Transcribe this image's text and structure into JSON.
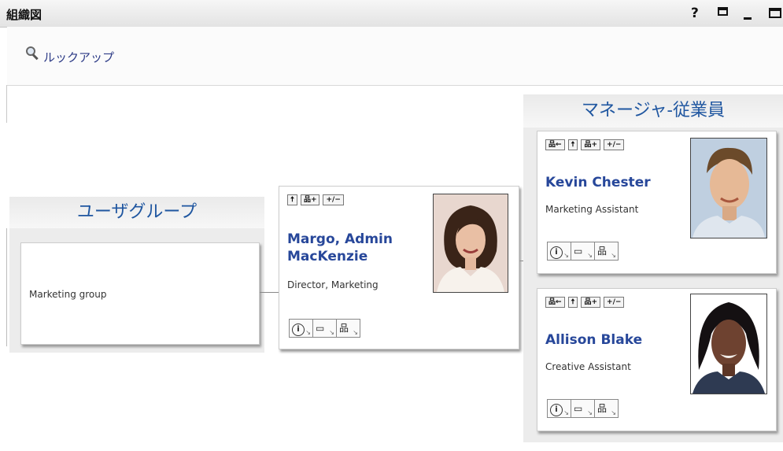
{
  "window": {
    "title": "組織図",
    "help_label": "?"
  },
  "lookup": {
    "label": "ルックアップ"
  },
  "user_groups": {
    "header": "ユーザグループ",
    "items": [
      {
        "name": "Marketing group"
      }
    ]
  },
  "center_person": {
    "name_line1": "Margo, Admin",
    "name_line2": "MacKenzie",
    "title": "Director, Marketing",
    "toolbar": [
      "🠅",
      "品+",
      "+/−"
    ]
  },
  "manager_employee": {
    "header": "マネージャ-従業員",
    "employees": [
      {
        "name": "Kevin Chester",
        "title": "Marketing Assistant"
      },
      {
        "name": "Allison Blake",
        "title": "Creative Assistant"
      }
    ]
  },
  "card_buttons": {
    "go_to_manager": "品←",
    "go_up": "🠅",
    "show_reports": "品+",
    "expand_collapse": "+/−",
    "info": "i"
  }
}
